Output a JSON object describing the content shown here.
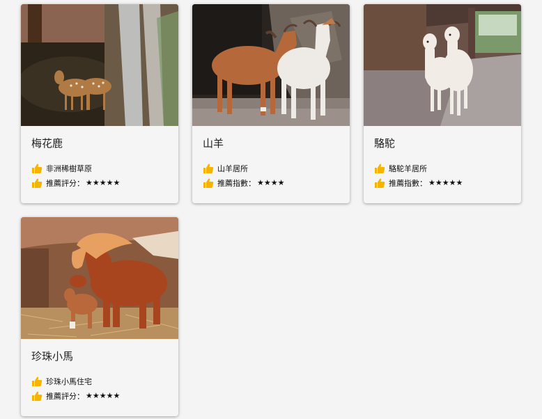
{
  "colors": {
    "page_background": "#f4f4f4",
    "card_background": "#f5f5f5",
    "thumb_icon": "#f4b400"
  },
  "cards": [
    {
      "title": "梅花鹿",
      "location": "非洲稀樹草原",
      "rating_label": "推薦評分：",
      "rating_stars": "★★★★★",
      "rating_value": 5,
      "photo_icon": "sika-deer-photo"
    },
    {
      "title": "山羊",
      "location": "山羊居所",
      "rating_label": "推薦指數：",
      "rating_stars": "★★★★",
      "rating_value": 4,
      "photo_icon": "goat-photo"
    },
    {
      "title": "駱駝",
      "location": "駱駝羊居所",
      "rating_label": "推薦指數：",
      "rating_stars": "★★★★★",
      "rating_value": 5,
      "photo_icon": "alpaca-photo"
    },
    {
      "title": "珍珠小馬",
      "location": "珍珠小馬住宅",
      "rating_label": "推薦評分：",
      "rating_stars": "★★★★★",
      "rating_value": 5,
      "photo_icon": "pony-photo"
    }
  ]
}
